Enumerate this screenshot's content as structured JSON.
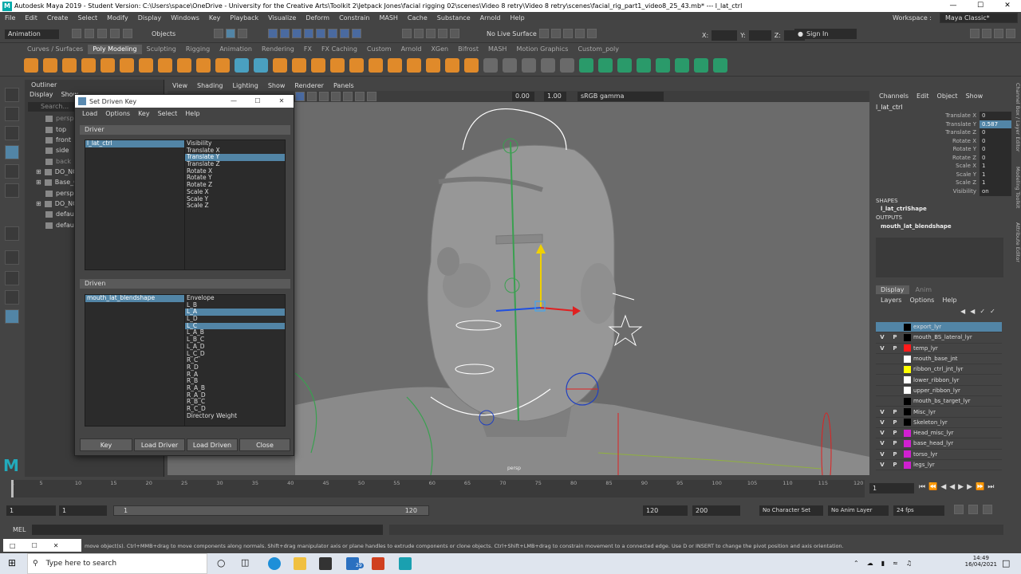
{
  "window": {
    "title": "Autodesk Maya 2019 - Student Version: C:\\Users\\space\\OneDrive - University for the Creative Arts\\Toolkit 2\\Jetpack Jones\\facial rigging 02\\scenes\\Video 8 retry\\Video 8 retry\\scenes\\facial_rig_part1_video8_25_43.mb*   ---   l_lat_ctrl",
    "min": "—",
    "max": "☐",
    "close": "✕"
  },
  "menubar": [
    "File",
    "Edit",
    "Create",
    "Select",
    "Modify",
    "Display",
    "Windows",
    "Key",
    "Playback",
    "Visualize",
    "Deform",
    "Constrain",
    "MASH",
    "Cache",
    "Substance",
    "Arnold",
    "Help"
  ],
  "workspace": {
    "label": "Workspace :",
    "value": "Maya Classic*"
  },
  "statusline": {
    "mode": "Animation",
    "objects": "Objects",
    "live_surface": "No Live Surface",
    "x": "X:",
    "y": "Y:",
    "z": "Z:",
    "sign_in": "Sign In"
  },
  "shelf_tabs": [
    "Curves / Surfaces",
    "Poly Modeling",
    "Sculpting",
    "Rigging",
    "Animation",
    "Rendering",
    "FX",
    "FX Caching",
    "Custom",
    "Arnold",
    "XGen",
    "Bifrost",
    "MASH",
    "Motion Graphics",
    "Custom_poly"
  ],
  "shelf_active": "Poly Modeling",
  "outliner": {
    "title": "Outliner",
    "menu": [
      "Display",
      "Show"
    ],
    "search": "Search...",
    "items": [
      "persp",
      "top",
      "front",
      "side",
      "back",
      "DO_NC",
      "Base_C",
      "persp1",
      "DO_NC",
      "default",
      "default"
    ]
  },
  "viewport": {
    "menu": [
      "View",
      "Shading",
      "Lighting",
      "Show",
      "Renderer",
      "Panels"
    ],
    "exposure": "0.00",
    "gamma": "1.00",
    "colorspace": "sRGB gamma",
    "camera_label": "persp"
  },
  "dialog": {
    "title": "Set Driven Key",
    "menu": [
      "Load",
      "Options",
      "Key",
      "Select",
      "Help"
    ],
    "driver_label": "Driver",
    "driver_node": "l_lat_ctrl",
    "driver_attrs": [
      "Visibility",
      "Translate X",
      "Translate Y",
      "Translate Z",
      "Rotate X",
      "Rotate Y",
      "Rotate Z",
      "Scale X",
      "Scale Y",
      "Scale Z"
    ],
    "driver_selected": "Translate Y",
    "driven_label": "Driven",
    "driven_node": "mouth_lat_blendshape",
    "driven_attrs": [
      "Envelope",
      "L_B",
      "L_A",
      "L_D",
      "L_C",
      "L_A_B",
      "L_B_C",
      "L_A_D",
      "L_C_D",
      "R_C",
      "R_D",
      "R_A",
      "R_B",
      "R_A_B",
      "R_A_D",
      "R_B_C",
      "R_C_D",
      "Directory Weight"
    ],
    "driven_selected": [
      "L_A",
      "L_C"
    ],
    "buttons": {
      "key": "Key",
      "load_driver": "Load Driver",
      "load_driven": "Load Driven",
      "close": "Close"
    }
  },
  "channel_box": {
    "menu": [
      "Channels",
      "Edit",
      "Object",
      "Show"
    ],
    "node": "l_lat_ctrl",
    "attrs": [
      {
        "name": "Translate X",
        "value": "0"
      },
      {
        "name": "Translate Y",
        "value": "0.587"
      },
      {
        "name": "Translate Z",
        "value": "0"
      },
      {
        "name": "Rotate X",
        "value": "0"
      },
      {
        "name": "Rotate Y",
        "value": "0"
      },
      {
        "name": "Rotate Z",
        "value": "0"
      },
      {
        "name": "Scale X",
        "value": "1"
      },
      {
        "name": "Scale Y",
        "value": "1"
      },
      {
        "name": "Scale Z",
        "value": "1"
      },
      {
        "name": "Visibility",
        "value": "on"
      }
    ],
    "highlighted": "Translate Y",
    "shapes_label": "SHAPES",
    "shape": "l_lat_ctrlShape",
    "outputs_label": "OUTPUTS",
    "output": "mouth_lat_blendshape",
    "side_tabs": [
      "Channel Box / Layer Editor",
      "Modeling Toolkit",
      "Attribute Editor"
    ]
  },
  "layers": {
    "tabs": [
      "Display",
      "Anim"
    ],
    "menu": [
      "Layers",
      "Options",
      "Help"
    ],
    "rows": [
      {
        "v": "",
        "p": "",
        "color": "#000000",
        "name": "export_lyr",
        "selected": true
      },
      {
        "v": "V",
        "p": "P",
        "color": "#000000",
        "name": "mouth_BS_lateral_lyr"
      },
      {
        "v": "V",
        "p": "P",
        "color": "#ff1a1a",
        "name": "temp_lyr"
      },
      {
        "v": "",
        "p": "",
        "color": "#ffffff",
        "name": "mouth_base_jnt"
      },
      {
        "v": "",
        "p": "",
        "color": "#ffff00",
        "name": "ribbon_ctrl_jnt_lyr"
      },
      {
        "v": "",
        "p": "",
        "color": "#ffffff",
        "name": "lower_ribbon_lyr"
      },
      {
        "v": "",
        "p": "",
        "color": "#ffffff",
        "name": "upper_ribbon_lyr"
      },
      {
        "v": "",
        "p": "",
        "color": "#000000",
        "name": "mouth_bs_target_lyr"
      },
      {
        "v": "V",
        "p": "P",
        "color": "#000000",
        "name": "Misc_lyr"
      },
      {
        "v": "V",
        "p": "P",
        "color": "#000000",
        "name": "Skeleton_lyr"
      },
      {
        "v": "V",
        "p": "P",
        "color": "#d020d0",
        "name": "Head_misc_lyr"
      },
      {
        "v": "V",
        "p": "P",
        "color": "#d020d0",
        "name": "base_head_lyr"
      },
      {
        "v": "V",
        "p": "P",
        "color": "#d020d0",
        "name": "torso_lyr"
      },
      {
        "v": "V",
        "p": "P",
        "color": "#d020d0",
        "name": "legs_lyr"
      }
    ]
  },
  "timeline": {
    "ticks": [
      "1",
      "5",
      "10",
      "15",
      "20",
      "25",
      "30",
      "35",
      "40",
      "45",
      "50",
      "55",
      "60",
      "65",
      "70",
      "75",
      "80",
      "85",
      "90",
      "95",
      "100",
      "105",
      "110",
      "115",
      "120"
    ],
    "current": "1",
    "range_start": "1",
    "range_start2": "1",
    "range_inner_start": "1",
    "range_inner_end": "120",
    "range_end": "120",
    "range_end2": "200",
    "character_set": "No Character Set",
    "anim_layer": "No Anim Layer",
    "fps": "24 fps"
  },
  "mel": {
    "label": "MEL"
  },
  "help_line": "move object(s). Ctrl+MMB+drag to move components along normals. Shift+drag manipulator axis or plane handles to extrude components or clone objects. Ctrl+Shift+LMB+drag to constrain movement to a connected edge. Use D or INSERT to change the pivot position and axis orientation.",
  "taskbar": {
    "search": "Type here to search",
    "time": "14:49",
    "date": "16/04/2021",
    "mail_badge": "29"
  }
}
